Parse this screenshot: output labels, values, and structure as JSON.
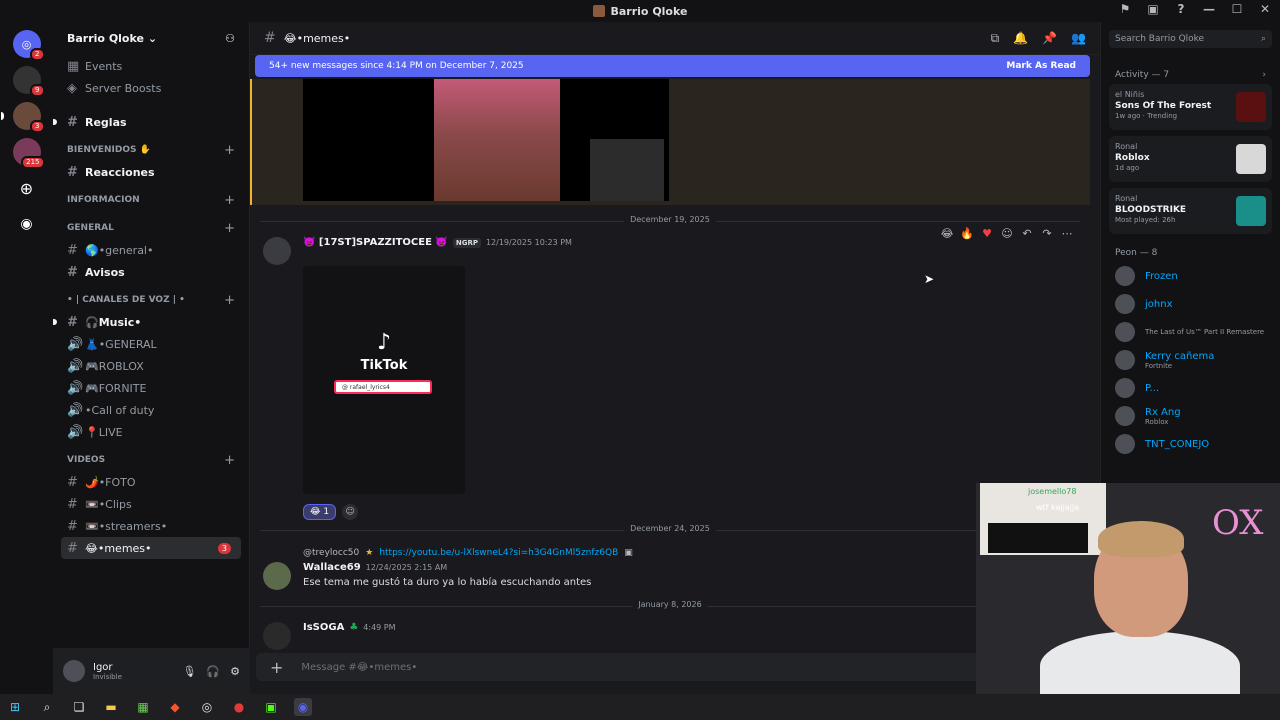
{
  "window": {
    "title": "Barrio Qloke"
  },
  "servers": [
    {
      "badge": "2"
    },
    {
      "badge": "9"
    },
    {
      "badge": "3"
    },
    {
      "badge": "215"
    }
  ],
  "sidebar": {
    "guild_name": "Barrio Qloke",
    "top_items": [
      {
        "label": "Events"
      },
      {
        "label": "Server Boosts"
      }
    ],
    "channels": {
      "reglas": "Reglas",
      "cat_bienvenidos": "BIENVENIDOS ✋",
      "reacciones": "Reacciones",
      "cat_informacion": "INFORMACION",
      "cat_general": "General",
      "general": "🌎•general•",
      "avisos": "Avisos",
      "cat_voz": "• | Canales de voz | •",
      "music": "🎧Music•",
      "v_general": "👗•GENERAL",
      "v_roblox": "🎮ROBLOX",
      "v_fornite": "🎮FORNITE",
      "v_cod": "•Call of duty",
      "v_live": "📍LIVE",
      "cat_videos": "VIDEOS",
      "foto": "🌶️•FOTO",
      "clips": "📼•Clips",
      "streamers": "📼•streamers•",
      "memes": "😂•memes•",
      "memes_badge": "3"
    },
    "user": {
      "name": "Igor",
      "status": "Invisible"
    }
  },
  "main": {
    "channel_name": "😂•memes•",
    "new_messages": "54+ new messages since 4:14 PM on December 7, 2025",
    "mark_as_read": "Mark As Read",
    "dividers": [
      "December 19, 2025",
      "December 24, 2025",
      "January 8, 2026"
    ],
    "msg1": {
      "author": "👿 [17ST]SPAZZITOCEE 👿",
      "tag": "NGRP",
      "time": "12/19/2025 10:23 PM",
      "tiktok": "TikTok",
      "search": "@ rafael_lyrics4",
      "reaction_count": "1"
    },
    "msg2": {
      "reply_user": "@treylocc50",
      "reply_link": "https://youtu.be/u-lXlswneL4?si=h3G4GnMl5znfz6QB",
      "author": "Wallace69",
      "time": "12/24/2025 2:15 AM",
      "text": "Ese tema me gustó ta duro ya lo había escuchando antes"
    },
    "msg3": {
      "author": "IsSOGA",
      "time": "4:49 PM"
    },
    "composer_placeholder": "Message #😂•memes•"
  },
  "rightpanel": {
    "search_placeholder": "Search Barrio Qloke",
    "activity_header": "Activity — 7",
    "activities": [
      {
        "user": "el Niñis",
        "game": "Sons Of The Forest",
        "sub": "1w ago · Trending"
      },
      {
        "user": "Ronal",
        "game": "Roblox",
        "sub": "1d ago"
      },
      {
        "user": "Ronal",
        "game": "BLOODSTRIKE",
        "sub": "Most played: 26h"
      }
    ],
    "members_header": "Peon — 8",
    "members": [
      {
        "name": "Frozen",
        "sub": ""
      },
      {
        "name": "johnx",
        "sub": ""
      },
      {
        "name": "",
        "sub": "The Last of Us™ Part II Remastere"
      },
      {
        "name": "Kerry cañema",
        "sub": "Fortnite"
      },
      {
        "name": "P...",
        "sub": ""
      },
      {
        "name": "Rx Ang",
        "sub": "Roblox"
      },
      {
        "name": "TNT_CONEJO",
        "sub": ""
      }
    ]
  },
  "webcam": {
    "chat_user": "josemello78",
    "chat_msg": "wtf kajjajja",
    "sign": "OX"
  }
}
